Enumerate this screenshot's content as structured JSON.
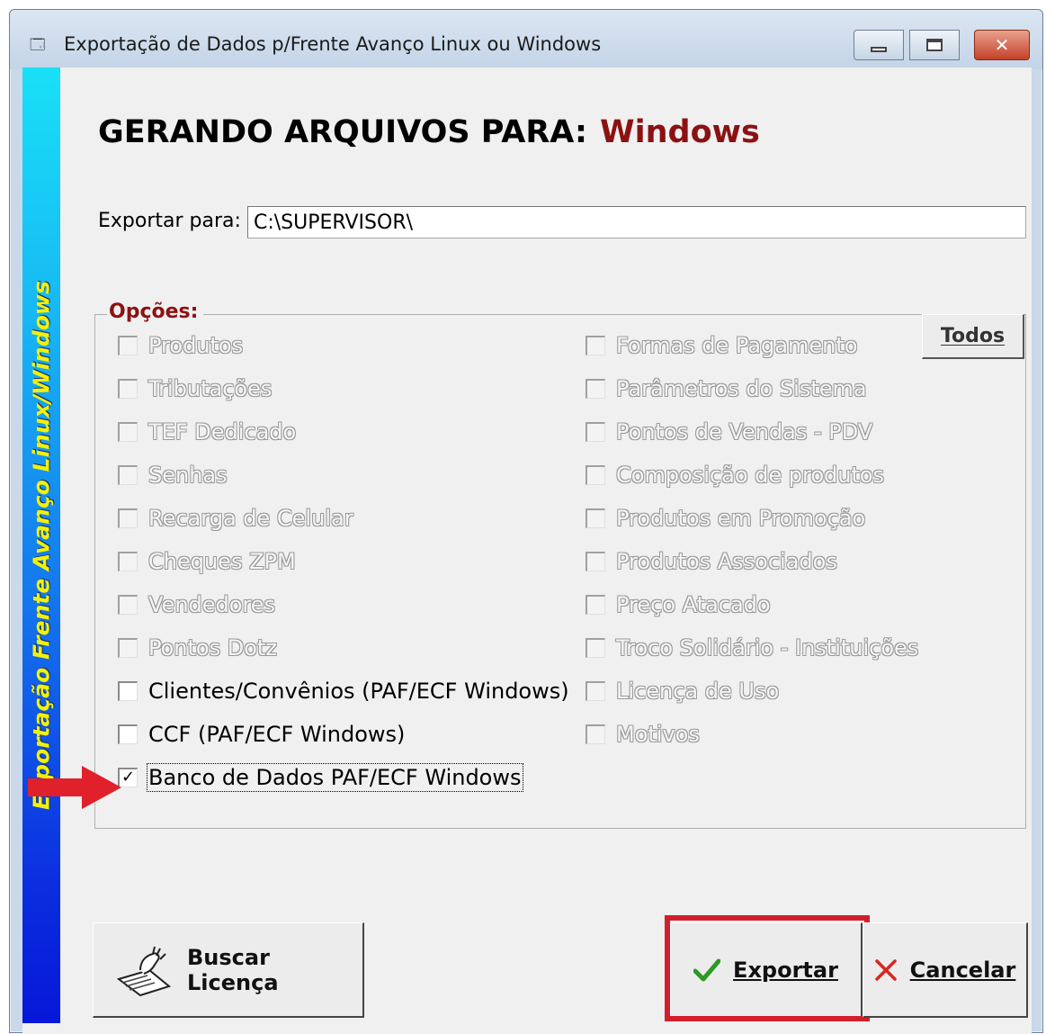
{
  "window": {
    "title": "Exportação de Dados p/Frente Avanço Linux ou Windows",
    "app_icon": "form-icon",
    "controls": {
      "minimize": "minimize-icon",
      "maximize": "maximize-icon",
      "close": "close-icon"
    }
  },
  "banner": {
    "text": "Exportação Frente Avanço Linux/Windows",
    "color": "#f1f10a"
  },
  "heading": {
    "label": "GERANDO ARQUIVOS PARA:",
    "target": "Windows",
    "target_color": "#8b1212"
  },
  "export_path": {
    "label": "Exportar para:",
    "value": "C:\\SUPERVISOR\\"
  },
  "options": {
    "title": "Opções:",
    "all_button": "Todos",
    "left": [
      {
        "label": "Produtos",
        "checked": false,
        "enabled": false
      },
      {
        "label": "Tributações",
        "checked": false,
        "enabled": false
      },
      {
        "label": "TEF Dedicado",
        "checked": false,
        "enabled": false
      },
      {
        "label": "Senhas",
        "checked": false,
        "enabled": false
      },
      {
        "label": "Recarga de Celular",
        "checked": false,
        "enabled": false
      },
      {
        "label": "Cheques ZPM",
        "checked": false,
        "enabled": false
      },
      {
        "label": "Vendedores",
        "checked": false,
        "enabled": false
      },
      {
        "label": "Pontos Dotz",
        "checked": false,
        "enabled": false
      },
      {
        "label": "Clientes/Convênios (PAF/ECF Windows)",
        "checked": false,
        "enabled": true
      },
      {
        "label": "CCF (PAF/ECF Windows)",
        "checked": false,
        "enabled": true
      },
      {
        "label": "Banco de Dados PAF/ECF Windows",
        "checked": true,
        "enabled": true
      }
    ],
    "right": [
      {
        "label": "Formas de Pagamento",
        "checked": false,
        "enabled": false
      },
      {
        "label": "Parâmetros do Sistema",
        "checked": false,
        "enabled": false
      },
      {
        "label": "Pontos de Vendas - PDV",
        "checked": false,
        "enabled": false
      },
      {
        "label": "Composição de produtos",
        "checked": false,
        "enabled": false
      },
      {
        "label": "Produtos em Promoção",
        "checked": false,
        "enabled": false
      },
      {
        "label": "Produtos Associados",
        "checked": false,
        "enabled": false
      },
      {
        "label": "Preço Atacado",
        "checked": false,
        "enabled": false
      },
      {
        "label": "Troco Solidário - Instituições",
        "checked": false,
        "enabled": false
      },
      {
        "label": "Licença de Uso",
        "checked": false,
        "enabled": false
      },
      {
        "label": "Motivos",
        "checked": false,
        "enabled": false
      }
    ]
  },
  "buttons": {
    "buscar": {
      "label": "Buscar Licença",
      "icon": "hand-document-icon"
    },
    "exportar": {
      "label": "Exportar",
      "icon": "checkmark-icon"
    },
    "cancelar": {
      "label": "Cancelar",
      "icon": "x-icon"
    }
  },
  "colors": {
    "highlight_frame": "#d21f2b",
    "annotation_arrow": "#e0202a"
  }
}
